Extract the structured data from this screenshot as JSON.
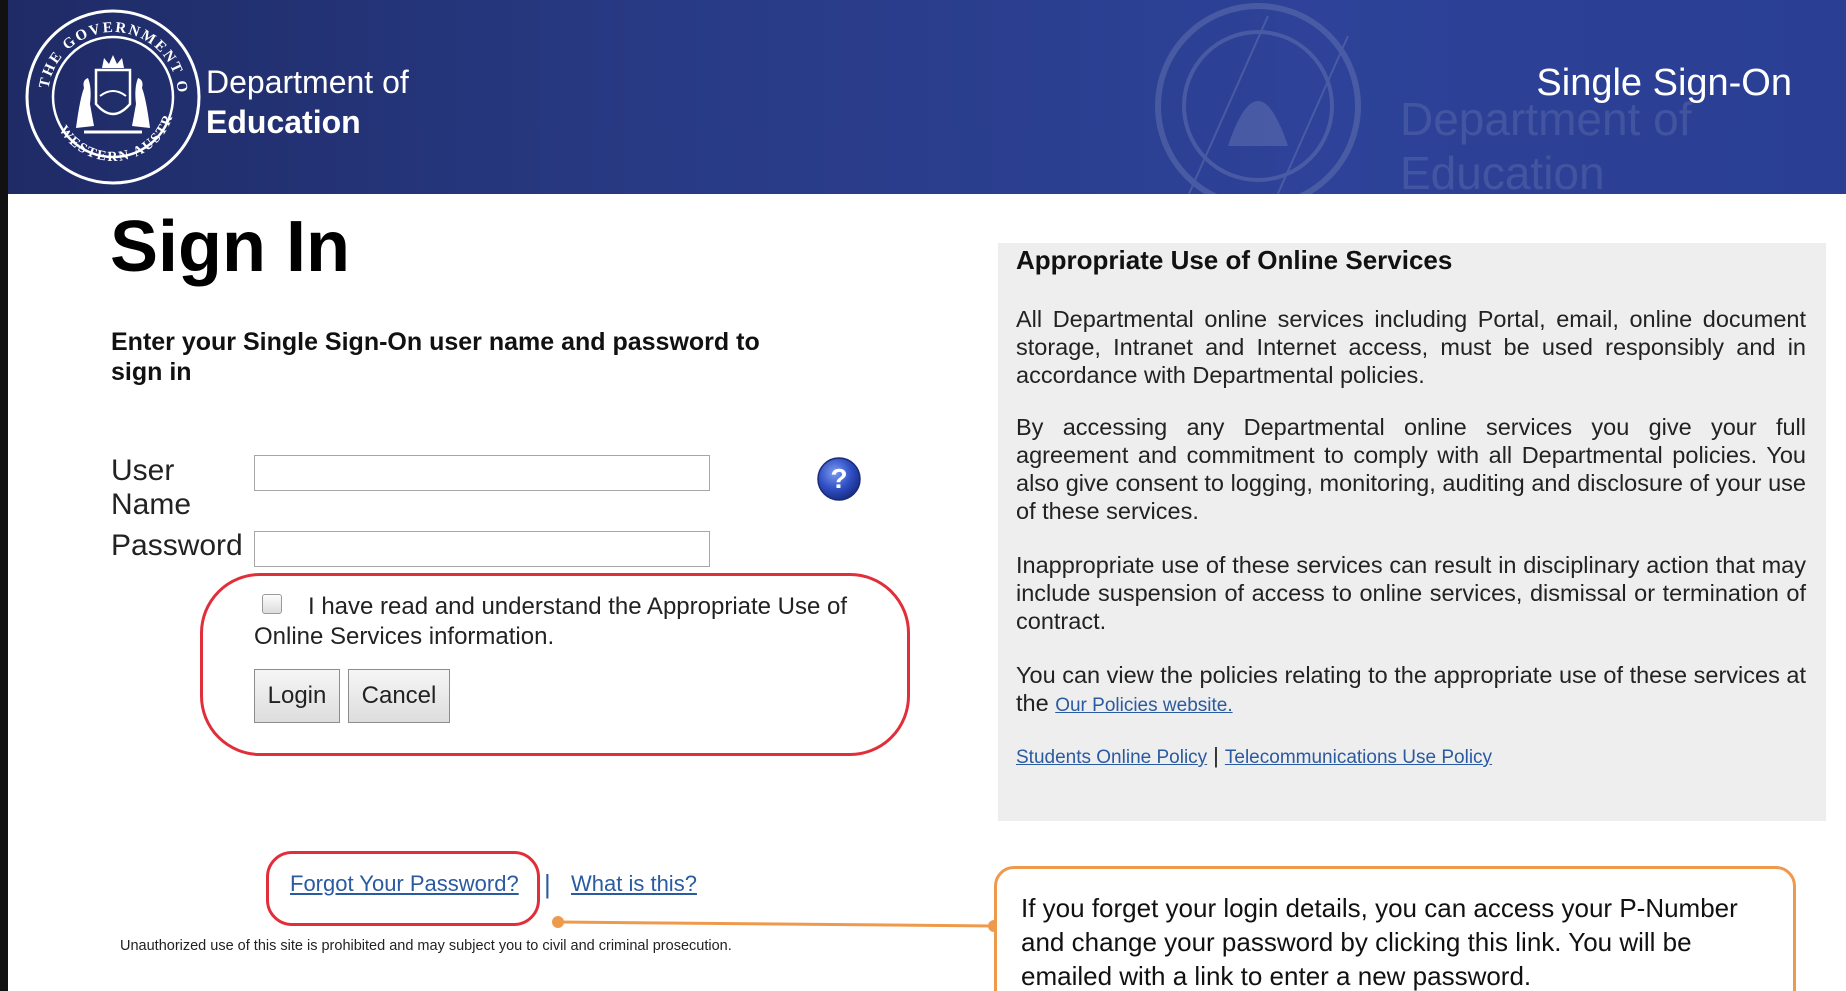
{
  "header": {
    "department_line1": "Department of",
    "department_line2": "Education",
    "app_title": "Single Sign-On",
    "crest_icon": "government-of-western-australia-crest",
    "watermark_line1": "Department of",
    "watermark_line2": "Education",
    "colors": {
      "banner_start": "#1f2b66",
      "banner_end": "#2a3f93"
    }
  },
  "signin": {
    "title": "Sign In",
    "instruction": "Enter your Single Sign-On user name and password to sign in",
    "user_name_label": "User Name",
    "user_name_value": "",
    "password_label": "Password",
    "password_value": "",
    "help_icon": "question-mark-icon",
    "agree_checked": false,
    "agree_text": "I have read and understand the Appropriate Use of Online Services information.",
    "login_label": "Login",
    "cancel_label": "Cancel",
    "forgot_password_label": "Forgot Your Password?",
    "separator": "|",
    "what_is_this_label": "What is this?",
    "legal_notice": "Unauthorized use of this site is prohibited and may subject you to civil and criminal prosecution."
  },
  "policy": {
    "title": "Appropriate Use of Online Services",
    "para1": "All Departmental online services including Portal, email, online document storage, Intranet and Internet access, must be used responsibly and in accordance with Departmental policies.",
    "para2": "By accessing any Departmental online services you give your full agreement and commitment to comply with all Departmental policies. You also give consent to logging, monitoring, auditing and disclosure of your use of these services.",
    "para3": "Inappropriate use of these services can result in disciplinary action that may include suspension of access to online services, dismissal or termination of contract.",
    "para4_prefix": "You can view the policies relating to the appropriate use of these services at the",
    "our_policies_link": "Our Policies website.",
    "students_policy_link": "Students Online Policy",
    "links_separator": "|",
    "telecom_policy_link": "Telecommunications Use Policy"
  },
  "callout": {
    "text": "If you forget your login details, you can access your P-Number and change your password by clicking this link. You will be emailed with a link to enter a new password.",
    "border_color": "#ee9a4d"
  },
  "annotation_colors": {
    "highlight_red": "#e02f3a",
    "link_blue": "#2a5aa0"
  }
}
